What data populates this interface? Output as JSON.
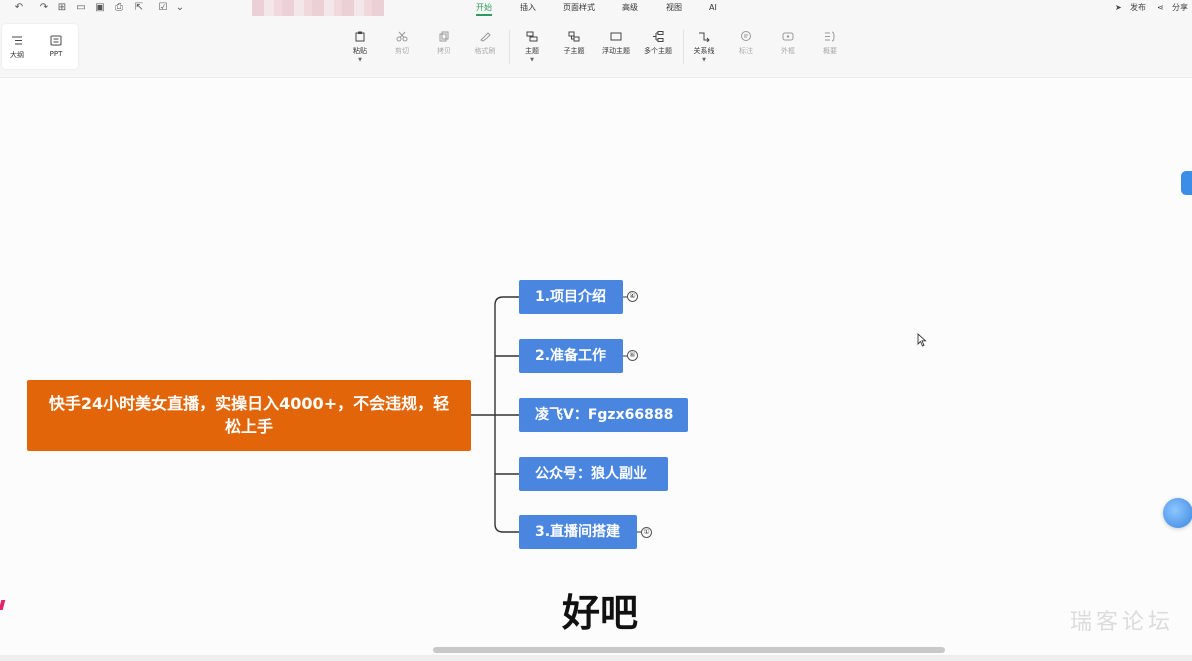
{
  "menu_tabs": [
    "开始",
    "插入",
    "页面样式",
    "高级",
    "视图",
    "AI"
  ],
  "active_tab": "开始",
  "header_right": {
    "publish": "发布",
    "share": "分享"
  },
  "left_panel": {
    "outline": "大纲",
    "ppt": "PPT"
  },
  "ribbon": {
    "paste": "粘贴",
    "cut": "剪切",
    "copy": "拷贝",
    "format_painter": "格式刷",
    "topic": "主题",
    "subtopic": "子主题",
    "floating_topic": "浮动主题",
    "multi_topic": "多个主题",
    "relationship": "关系线",
    "callout": "标注",
    "boundary": "外框",
    "summary": "概要"
  },
  "mindmap": {
    "root": "快手24小时美女直播，实操日入4000+，不会违规，轻松上手",
    "children": [
      {
        "label": "1.项目介绍",
        "badge": "④"
      },
      {
        "label": "2.准备工作",
        "badge": "⑥"
      },
      {
        "label": "凌飞V：Fgzx66888",
        "badge": ""
      },
      {
        "label": "公众号：狼人副业",
        "badge": ""
      },
      {
        "label": "3.直播间搭建",
        "badge": "①"
      }
    ]
  },
  "subtitle": "好吧",
  "watermark": "瑞客论坛",
  "colors": {
    "root": "#e2650a",
    "child": "#4a86df",
    "accent": "#2b9a5b"
  }
}
